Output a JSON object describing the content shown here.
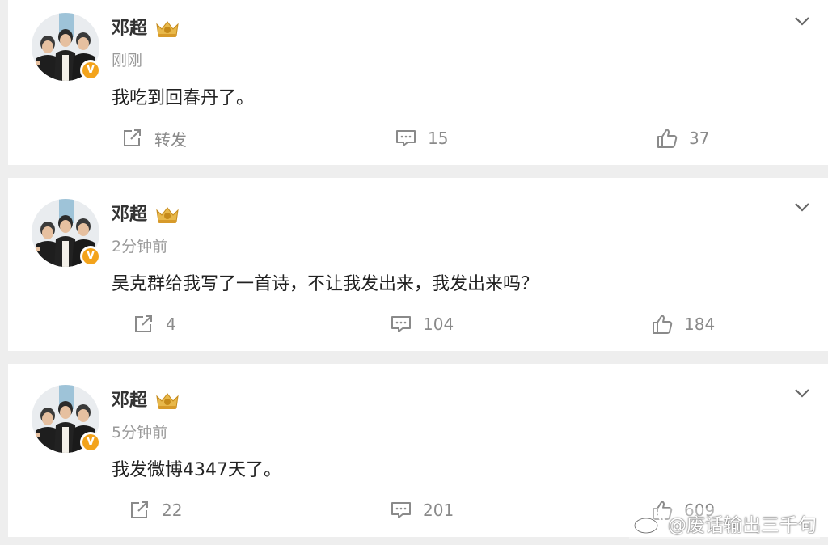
{
  "posts": [
    {
      "author": "邓超",
      "time": "刚刚",
      "content": "我吃到回春丹了。",
      "share_label": "转发",
      "comments": "15",
      "likes": "37"
    },
    {
      "author": "邓超",
      "time": "2分钟前",
      "content": "吴克群给我写了一首诗，不让我发出来，我发出来吗？",
      "share_label": "4",
      "comments": "104",
      "likes": "184"
    },
    {
      "author": "邓超",
      "time": "5分钟前",
      "content": "我发微博4347天了。",
      "share_label": "22",
      "comments": "201",
      "likes": "609"
    }
  ],
  "watermark": "@废话输出三千句",
  "colors": {
    "verified_badge": "#f3a31b",
    "action_gray": "#8a8a8a",
    "background": "#eeeeee"
  }
}
